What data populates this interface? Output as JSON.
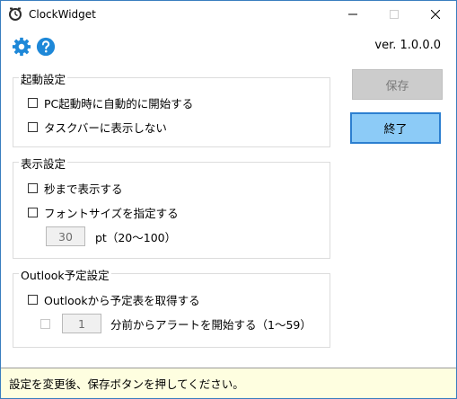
{
  "window": {
    "title": "ClockWidget"
  },
  "header": {
    "version": "ver. 1.0.0.0"
  },
  "startup": {
    "label": "起動設定",
    "start_on_boot": {
      "label": "PC起動時に自動的に開始する",
      "checked": false
    },
    "hide_taskbar": {
      "label": "タスクバーに表示しない",
      "checked": false
    }
  },
  "display": {
    "label": "表示設定",
    "show_seconds": {
      "label": "秒まで表示する",
      "checked": false
    },
    "font_size": {
      "label": "フォントサイズを指定する",
      "checked": false,
      "value": "30",
      "unit": "pt（20～100）"
    }
  },
  "outlook": {
    "label": "Outlook予定設定",
    "fetch": {
      "label": "Outlookから予定表を取得する",
      "checked": false
    },
    "alert": {
      "value": "1",
      "label": "分前からアラートを開始する（1～59）",
      "checked": false
    }
  },
  "buttons": {
    "save": "保存",
    "exit": "終了"
  },
  "status": {
    "message": "設定を変更後、保存ボタンを押してください。"
  },
  "colors": {
    "accent": "#1e88d8",
    "exit_bg": "#8ccbf7",
    "status_bg": "#fefee0"
  }
}
